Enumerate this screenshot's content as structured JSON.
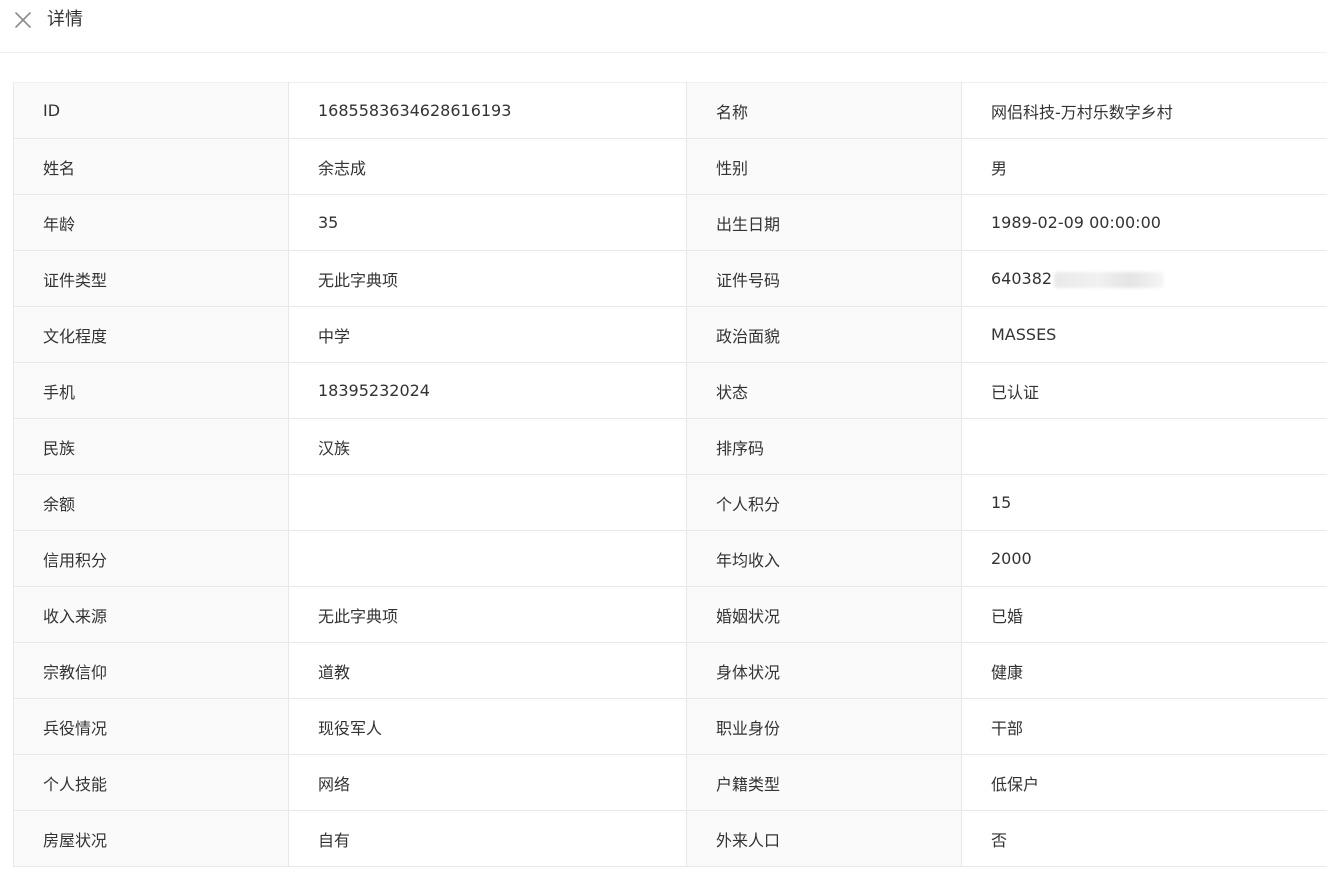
{
  "header": {
    "title": "详情",
    "close_icon": "close-icon"
  },
  "rows": [
    [
      {
        "label": "ID",
        "value": "1685583634628616193"
      },
      {
        "label": "名称",
        "value": "网侣科技-万村乐数字乡村"
      }
    ],
    [
      {
        "label": "姓名",
        "value": "余志成"
      },
      {
        "label": "性别",
        "value": "男"
      }
    ],
    [
      {
        "label": "年龄",
        "value": "35"
      },
      {
        "label": "出生日期",
        "value": "1989-02-09 00:00:00"
      }
    ],
    [
      {
        "label": "证件类型",
        "value": "无此字典项"
      },
      {
        "label": "证件号码",
        "value": "640382"
      }
    ],
    [
      {
        "label": "文化程度",
        "value": "中学"
      },
      {
        "label": "政治面貌",
        "value": "MASSES"
      }
    ],
    [
      {
        "label": "手机",
        "value": "18395232024"
      },
      {
        "label": "状态",
        "value": "已认证"
      }
    ],
    [
      {
        "label": "民族",
        "value": "汉族"
      },
      {
        "label": "排序码",
        "value": ""
      }
    ],
    [
      {
        "label": "余额",
        "value": ""
      },
      {
        "label": "个人积分",
        "value": "15"
      }
    ],
    [
      {
        "label": "信用积分",
        "value": ""
      },
      {
        "label": "年均收入",
        "value": "2000"
      }
    ],
    [
      {
        "label": "收入来源",
        "value": "无此字典项"
      },
      {
        "label": "婚姻状况",
        "value": "已婚"
      }
    ],
    [
      {
        "label": "宗教信仰",
        "value": "道教"
      },
      {
        "label": "身体状况",
        "value": "健康"
      }
    ],
    [
      {
        "label": "兵役情况",
        "value": "现役军人"
      },
      {
        "label": "职业身份",
        "value": "干部"
      }
    ],
    [
      {
        "label": "个人技能",
        "value": "网络"
      },
      {
        "label": "户籍类型",
        "value": "低保户"
      }
    ],
    [
      {
        "label": "房屋状况",
        "value": "自有"
      },
      {
        "label": "外来人口",
        "value": "否"
      }
    ]
  ]
}
